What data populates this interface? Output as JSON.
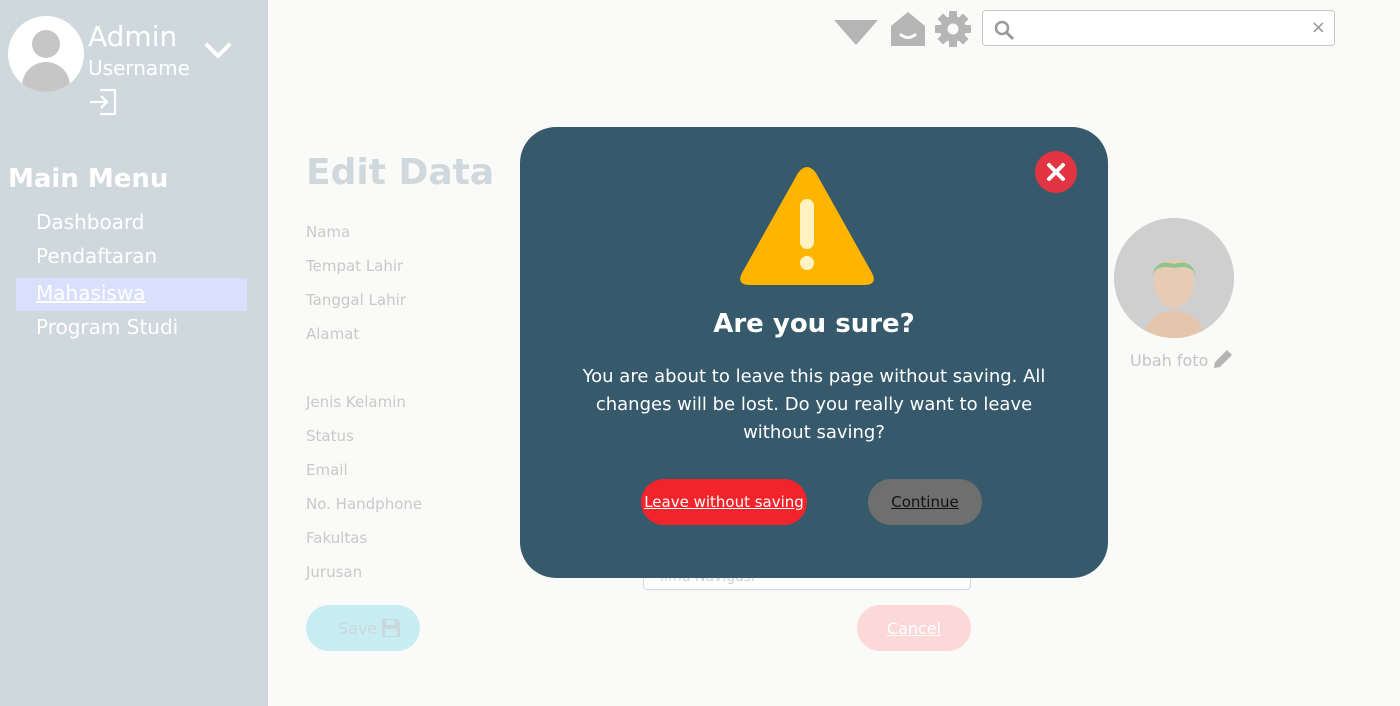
{
  "sidebar": {
    "user_name": "Admin",
    "user_role": "Username",
    "avatar_icon": "user-avatar-icon",
    "menu_title": "Main Menu",
    "items": [
      {
        "label": "Dashboard",
        "active": false
      },
      {
        "label": "Pendaftaran",
        "active": false
      },
      {
        "label": "Mahasiswa",
        "active": true
      },
      {
        "label": "Program Studi",
        "active": false
      }
    ]
  },
  "topbar": {
    "icons": [
      "triangle-dropdown-icon",
      "home-icon",
      "gear-icon"
    ],
    "search": {
      "value": "",
      "placeholder": "",
      "clear_label": "×"
    }
  },
  "form": {
    "title": "Edit Data",
    "labels": [
      "Nama",
      "Tempat Lahir",
      "Tanggal Lahir",
      "Alamat",
      "Jenis Kelamin",
      "Status",
      "Email",
      "No. Handphone",
      "Fakultas",
      "Jurusan"
    ],
    "jurusan_value": "Ilmu Navigasi",
    "change_photo_label": "Ubah foto",
    "save_label": "Save",
    "cancel_label": "Cancel"
  },
  "modal": {
    "title": "Are you sure?",
    "message": "You are about to leave this page without saving. All changes will be lost. Do you really want to leave without saving?",
    "leave_label": "Leave without saving",
    "continue_label": "Continue"
  },
  "colors": {
    "sidebar_bg": "#cfd8dd",
    "modal_bg": "#365a6b",
    "warning": "#ffb400",
    "danger": "#f1242b",
    "close": "#e23442"
  }
}
